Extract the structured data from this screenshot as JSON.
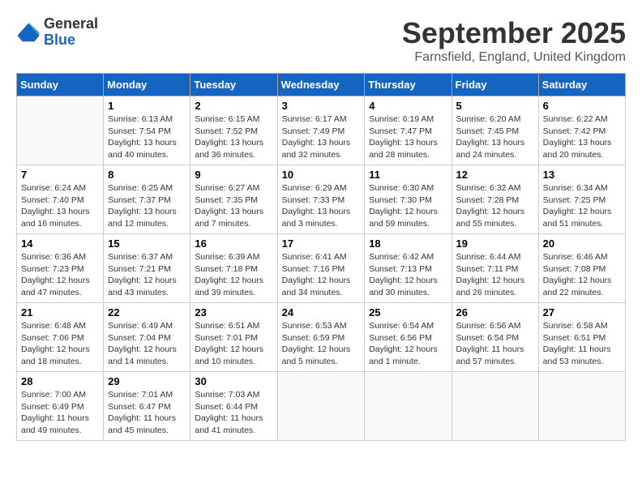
{
  "header": {
    "logo_line1": "General",
    "logo_line2": "Blue",
    "month": "September 2025",
    "location": "Farnsfield, England, United Kingdom"
  },
  "days_of_week": [
    "Sunday",
    "Monday",
    "Tuesday",
    "Wednesday",
    "Thursday",
    "Friday",
    "Saturday"
  ],
  "weeks": [
    [
      {
        "day": "",
        "info": ""
      },
      {
        "day": "1",
        "info": "Sunrise: 6:13 AM\nSunset: 7:54 PM\nDaylight: 13 hours\nand 40 minutes."
      },
      {
        "day": "2",
        "info": "Sunrise: 6:15 AM\nSunset: 7:52 PM\nDaylight: 13 hours\nand 36 minutes."
      },
      {
        "day": "3",
        "info": "Sunrise: 6:17 AM\nSunset: 7:49 PM\nDaylight: 13 hours\nand 32 minutes."
      },
      {
        "day": "4",
        "info": "Sunrise: 6:19 AM\nSunset: 7:47 PM\nDaylight: 13 hours\nand 28 minutes."
      },
      {
        "day": "5",
        "info": "Sunrise: 6:20 AM\nSunset: 7:45 PM\nDaylight: 13 hours\nand 24 minutes."
      },
      {
        "day": "6",
        "info": "Sunrise: 6:22 AM\nSunset: 7:42 PM\nDaylight: 13 hours\nand 20 minutes."
      }
    ],
    [
      {
        "day": "7",
        "info": "Sunrise: 6:24 AM\nSunset: 7:40 PM\nDaylight: 13 hours\nand 16 minutes."
      },
      {
        "day": "8",
        "info": "Sunrise: 6:25 AM\nSunset: 7:37 PM\nDaylight: 13 hours\nand 12 minutes."
      },
      {
        "day": "9",
        "info": "Sunrise: 6:27 AM\nSunset: 7:35 PM\nDaylight: 13 hours\nand 7 minutes."
      },
      {
        "day": "10",
        "info": "Sunrise: 6:29 AM\nSunset: 7:33 PM\nDaylight: 13 hours\nand 3 minutes."
      },
      {
        "day": "11",
        "info": "Sunrise: 6:30 AM\nSunset: 7:30 PM\nDaylight: 12 hours\nand 59 minutes."
      },
      {
        "day": "12",
        "info": "Sunrise: 6:32 AM\nSunset: 7:28 PM\nDaylight: 12 hours\nand 55 minutes."
      },
      {
        "day": "13",
        "info": "Sunrise: 6:34 AM\nSunset: 7:25 PM\nDaylight: 12 hours\nand 51 minutes."
      }
    ],
    [
      {
        "day": "14",
        "info": "Sunrise: 6:36 AM\nSunset: 7:23 PM\nDaylight: 12 hours\nand 47 minutes."
      },
      {
        "day": "15",
        "info": "Sunrise: 6:37 AM\nSunset: 7:21 PM\nDaylight: 12 hours\nand 43 minutes."
      },
      {
        "day": "16",
        "info": "Sunrise: 6:39 AM\nSunset: 7:18 PM\nDaylight: 12 hours\nand 39 minutes."
      },
      {
        "day": "17",
        "info": "Sunrise: 6:41 AM\nSunset: 7:16 PM\nDaylight: 12 hours\nand 34 minutes."
      },
      {
        "day": "18",
        "info": "Sunrise: 6:42 AM\nSunset: 7:13 PM\nDaylight: 12 hours\nand 30 minutes."
      },
      {
        "day": "19",
        "info": "Sunrise: 6:44 AM\nSunset: 7:11 PM\nDaylight: 12 hours\nand 26 minutes."
      },
      {
        "day": "20",
        "info": "Sunrise: 6:46 AM\nSunset: 7:08 PM\nDaylight: 12 hours\nand 22 minutes."
      }
    ],
    [
      {
        "day": "21",
        "info": "Sunrise: 6:48 AM\nSunset: 7:06 PM\nDaylight: 12 hours\nand 18 minutes."
      },
      {
        "day": "22",
        "info": "Sunrise: 6:49 AM\nSunset: 7:04 PM\nDaylight: 12 hours\nand 14 minutes."
      },
      {
        "day": "23",
        "info": "Sunrise: 6:51 AM\nSunset: 7:01 PM\nDaylight: 12 hours\nand 10 minutes."
      },
      {
        "day": "24",
        "info": "Sunrise: 6:53 AM\nSunset: 6:59 PM\nDaylight: 12 hours\nand 5 minutes."
      },
      {
        "day": "25",
        "info": "Sunrise: 6:54 AM\nSunset: 6:56 PM\nDaylight: 12 hours\nand 1 minute."
      },
      {
        "day": "26",
        "info": "Sunrise: 6:56 AM\nSunset: 6:54 PM\nDaylight: 11 hours\nand 57 minutes."
      },
      {
        "day": "27",
        "info": "Sunrise: 6:58 AM\nSunset: 6:51 PM\nDaylight: 11 hours\nand 53 minutes."
      }
    ],
    [
      {
        "day": "28",
        "info": "Sunrise: 7:00 AM\nSunset: 6:49 PM\nDaylight: 11 hours\nand 49 minutes."
      },
      {
        "day": "29",
        "info": "Sunrise: 7:01 AM\nSunset: 6:47 PM\nDaylight: 11 hours\nand 45 minutes."
      },
      {
        "day": "30",
        "info": "Sunrise: 7:03 AM\nSunset: 6:44 PM\nDaylight: 11 hours\nand 41 minutes."
      },
      {
        "day": "",
        "info": ""
      },
      {
        "day": "",
        "info": ""
      },
      {
        "day": "",
        "info": ""
      },
      {
        "day": "",
        "info": ""
      }
    ]
  ]
}
